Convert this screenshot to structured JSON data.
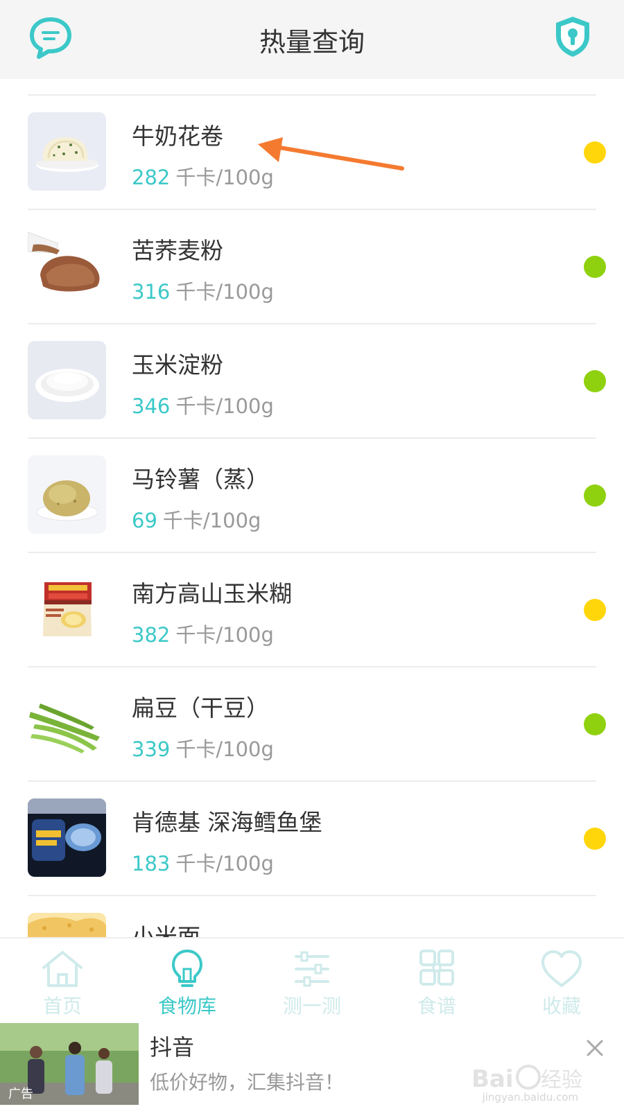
{
  "header": {
    "title": "热量查询",
    "chat_icon": "chat-bubble-icon",
    "shield_icon": "shield-lock-icon"
  },
  "colors": {
    "accent": "#3cc8c8",
    "dot_yellow": "#ffd60a",
    "dot_green": "#8fd10f",
    "annotation_arrow": "#f47a30"
  },
  "foods": [
    {
      "name": "牛奶花卷",
      "kcal": "282",
      "unit": "千卡/100g",
      "status": "yellow",
      "thumb": "milk-bun"
    },
    {
      "name": "苦荞麦粉",
      "kcal": "316",
      "unit": "千卡/100g",
      "status": "green",
      "thumb": "buckwheat-flour"
    },
    {
      "name": "玉米淀粉",
      "kcal": "346",
      "unit": "千卡/100g",
      "status": "green",
      "thumb": "corn-starch"
    },
    {
      "name": "马铃薯（蒸）",
      "kcal": "69",
      "unit": "千卡/100g",
      "status": "green",
      "thumb": "potato"
    },
    {
      "name": "南方高山玉米糊",
      "kcal": "382",
      "unit": "千卡/100g",
      "status": "yellow",
      "thumb": "corn-paste-bag"
    },
    {
      "name": "扁豆（干豆）",
      "kcal": "339",
      "unit": "千卡/100g",
      "status": "green",
      "thumb": "green-beans"
    },
    {
      "name": "肯德基 深海鳕鱼堡",
      "kcal": "183",
      "unit": "千卡/100g",
      "status": "yellow",
      "thumb": "fish-burger-box"
    },
    {
      "name": "小米面",
      "kcal": "",
      "unit": "",
      "status": "",
      "thumb": "millet-cake"
    }
  ],
  "tabbar": {
    "tabs": [
      {
        "label": "首页",
        "icon": "home-icon"
      },
      {
        "label": "食物库",
        "icon": "lightbulb-icon"
      },
      {
        "label": "测一测",
        "icon": "sliders-icon"
      },
      {
        "label": "食谱",
        "icon": "grid-icon"
      },
      {
        "label": "收藏",
        "icon": "heart-icon"
      }
    ],
    "active": "食物库"
  },
  "ad": {
    "tag": "广告",
    "title": "抖音",
    "description": "低价好物，汇集抖音！",
    "close_icon": "close-icon"
  },
  "watermark": {
    "logo": "Baidu经验",
    "url": "jingyan.baidu.com"
  }
}
